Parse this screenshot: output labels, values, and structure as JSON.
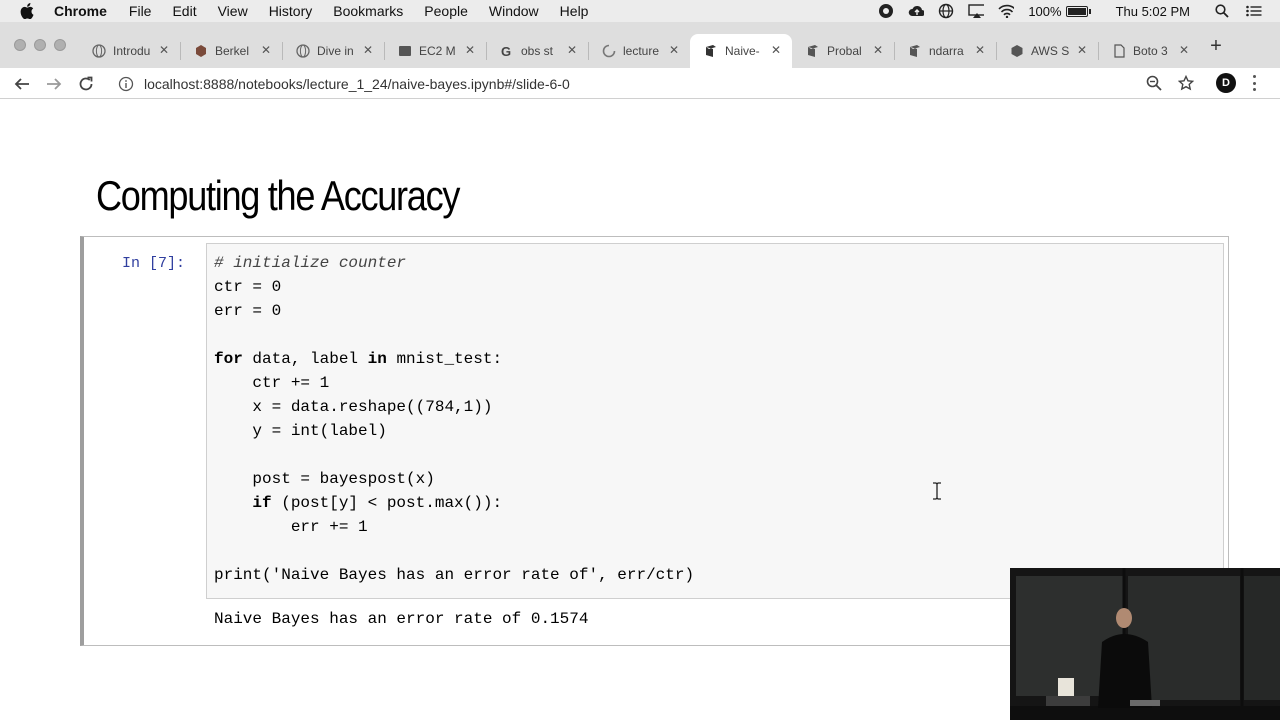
{
  "menubar": {
    "app_name": "Chrome",
    "items": [
      "File",
      "Edit",
      "View",
      "History",
      "Bookmarks",
      "People",
      "Window",
      "Help"
    ],
    "battery_pct": "100%",
    "battery_level": 1.0,
    "clock": "Thu 5:02 PM",
    "status_icons": [
      "creative-cloud-icon",
      "cloud-upload-icon",
      "globe-icon",
      "airplay-icon",
      "wifi-icon"
    ]
  },
  "tabs": [
    {
      "label": "Introdu",
      "icon": "globe-icon",
      "active": false
    },
    {
      "label": "Berkel",
      "icon": "berkeley-icon",
      "active": false
    },
    {
      "label": "Dive in",
      "icon": "globe-icon",
      "active": false
    },
    {
      "label": "EC2 M",
      "icon": "aws-icon",
      "active": false
    },
    {
      "label": "obs st",
      "icon": "google-icon",
      "active": false
    },
    {
      "label": "lecture",
      "icon": "loading-icon",
      "active": false
    },
    {
      "label": "Naive-",
      "icon": "notebook-icon",
      "active": true
    },
    {
      "label": "Probal",
      "icon": "notebook-icon",
      "active": false
    },
    {
      "label": "ndarra",
      "icon": "notebook-icon",
      "active": false
    },
    {
      "label": "AWS S",
      "icon": "aws-icon",
      "active": false
    },
    {
      "label": "Boto 3",
      "icon": "page-icon",
      "active": false
    }
  ],
  "toolbar": {
    "url": "localhost:8888/notebooks/lecture_1_24/naive-bayes.ipynb#/slide-6-0",
    "profile_initial": "D"
  },
  "notebook": {
    "title": "Computing the Accuracy",
    "prompt": "In [7]:",
    "code": [
      [
        {
          "t": "# initialize counter",
          "c": "cm"
        }
      ],
      [
        {
          "t": "ctr = 0",
          "c": ""
        }
      ],
      [
        {
          "t": "err = 0",
          "c": ""
        }
      ],
      [],
      [
        {
          "t": "for",
          "c": "kw"
        },
        {
          "t": " data, label ",
          "c": ""
        },
        {
          "t": "in",
          "c": "kw"
        },
        {
          "t": " mnist_test:",
          "c": ""
        }
      ],
      [
        {
          "t": "    ctr += 1",
          "c": ""
        }
      ],
      [
        {
          "t": "    x = data.reshape((784,1))",
          "c": ""
        }
      ],
      [
        {
          "t": "    y = int(label)",
          "c": ""
        }
      ],
      [],
      [
        {
          "t": "    post = bayespost(x)",
          "c": ""
        }
      ],
      [
        {
          "t": "    ",
          "c": ""
        },
        {
          "t": "if",
          "c": "kw"
        },
        {
          "t": " (post[y] < post.max()):",
          "c": ""
        }
      ],
      [
        {
          "t": "        err += 1",
          "c": ""
        }
      ],
      [],
      [
        {
          "t": "print('Naive Bayes has an error rate of', err/ctr)",
          "c": ""
        }
      ]
    ],
    "output": "Naive Bayes has an error rate of 0.1574"
  }
}
